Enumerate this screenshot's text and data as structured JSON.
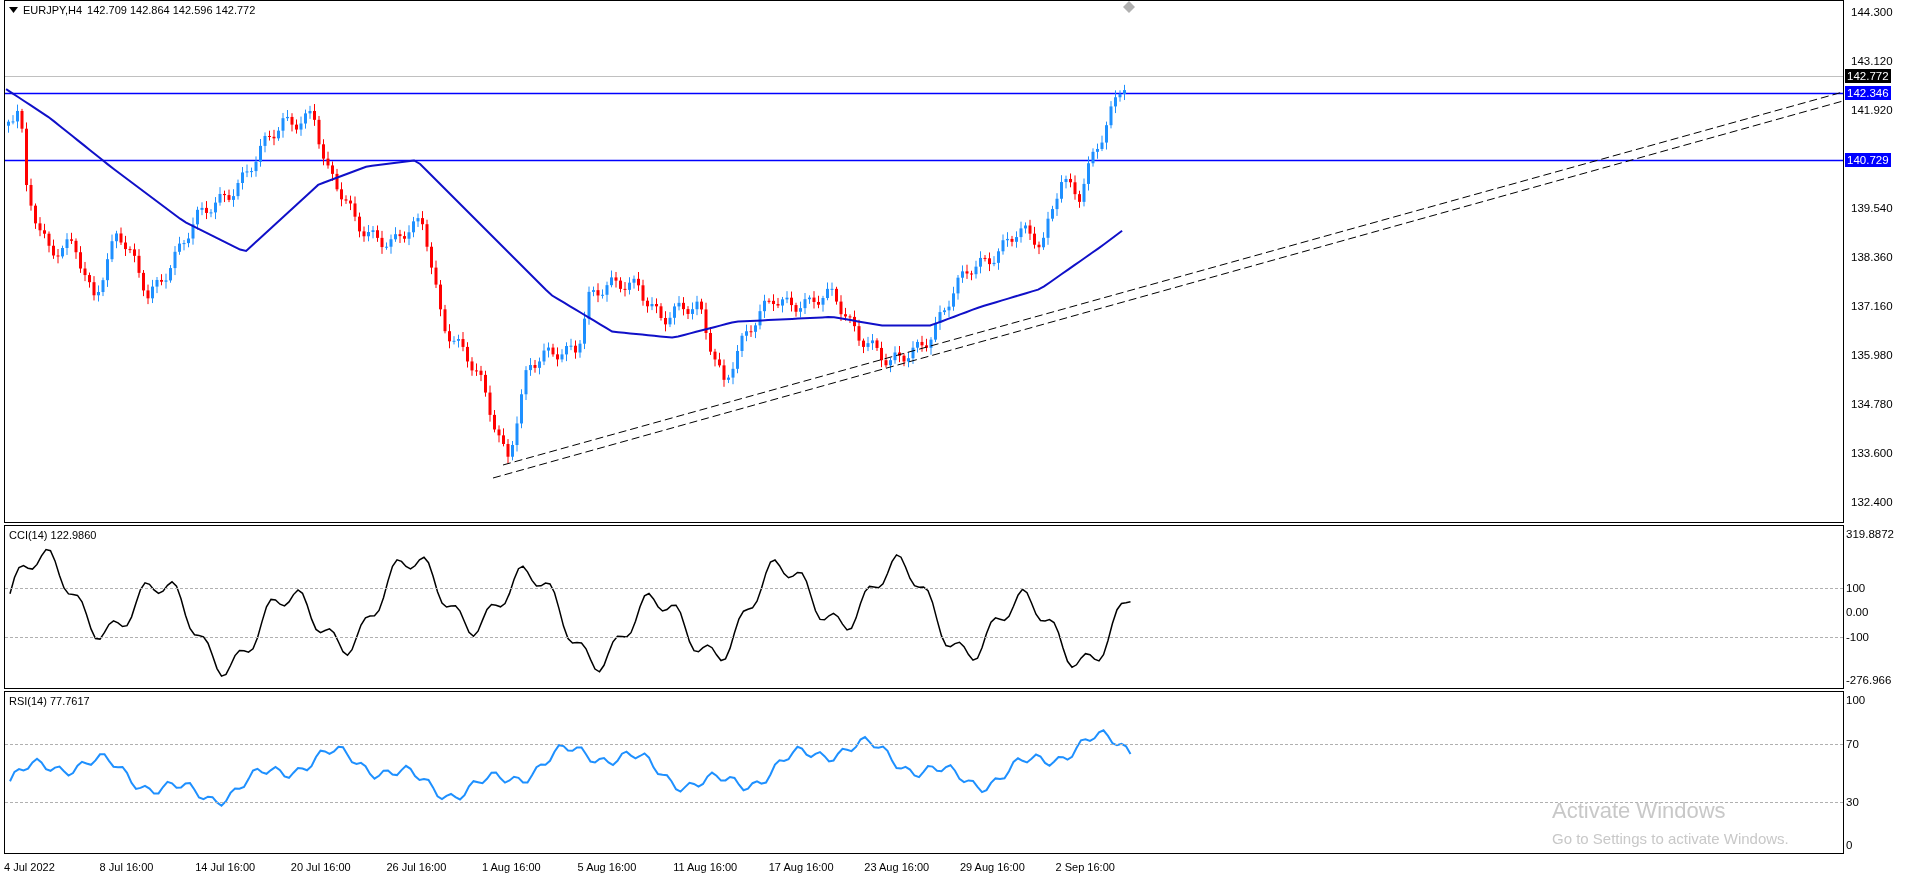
{
  "chart": {
    "symbol": "EURJPY,H4",
    "ohlc": "142.709 142.864 142.596 142.772",
    "price_ticks": [
      "144.300",
      "143.120",
      "141.920",
      "139.540",
      "138.360",
      "137.160",
      "135.980",
      "134.780",
      "133.600",
      "132.400"
    ],
    "price_tags": [
      {
        "kind": "current",
        "text": "142.772"
      },
      {
        "kind": "level",
        "text": "142.346"
      },
      {
        "kind": "level",
        "text": "140.729"
      }
    ]
  },
  "cci": {
    "label": "CCI(14) 122.9860",
    "ticks": [
      {
        "text": "319.8872",
        "grid": false
      },
      {
        "text": "100",
        "grid": true
      },
      {
        "text": "0.00",
        "grid": false
      },
      {
        "text": "-100",
        "grid": true
      },
      {
        "text": "-276.966",
        "grid": false
      }
    ]
  },
  "rsi": {
    "label": "RSI(14) 77.7617",
    "ticks": [
      {
        "text": "100",
        "grid": false
      },
      {
        "text": "70",
        "grid": true
      },
      {
        "text": "30",
        "grid": true
      },
      {
        "text": "0",
        "grid": false
      }
    ]
  },
  "time_axis": [
    "4 Jul 2022",
    "8 Jul 16:00",
    "14 Jul 16:00",
    "20 Jul 16:00",
    "26 Jul 16:00",
    "1 Aug 16:00",
    "5 Aug 16:00",
    "11 Aug 16:00",
    "17 Aug 16:00",
    "23 Aug 16:00",
    "29 Aug 16:00",
    "2 Sep 16:00"
  ],
  "watermark": {
    "title": "Activate Windows",
    "subtitle": "Go to Settings to activate Windows."
  }
}
